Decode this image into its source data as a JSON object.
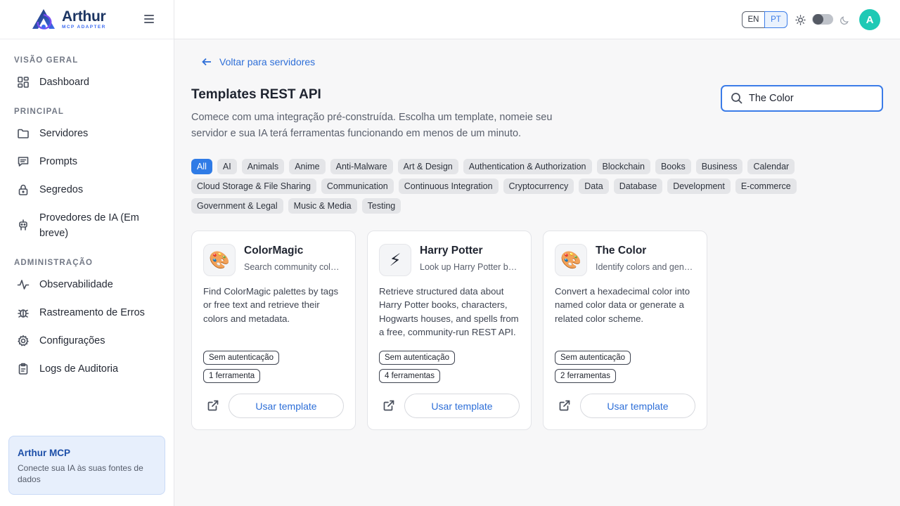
{
  "brand": {
    "name": "Arthur",
    "subtitle": "MCP ADAPTER"
  },
  "sidebar": {
    "sections": [
      {
        "title": "VISÃO GERAL"
      },
      {
        "title": "PRINCIPAL"
      },
      {
        "title": "ADMINISTRAÇÃO"
      }
    ],
    "items": [
      {
        "label": "Dashboard",
        "icon": "dashboard-icon"
      },
      {
        "label": "Servidores",
        "icon": "folder-icon"
      },
      {
        "label": "Prompts",
        "icon": "message-icon"
      },
      {
        "label": "Segredos",
        "icon": "lock-icon"
      },
      {
        "label": "Provedores de IA (Em breve)",
        "icon": "robot-icon"
      },
      {
        "label": "Observabilidade",
        "icon": "activity-icon"
      },
      {
        "label": "Rastreamento de Erros",
        "icon": "bug-icon"
      },
      {
        "label": "Configurações",
        "icon": "gear-icon"
      },
      {
        "label": "Logs de Auditoria",
        "icon": "clipboard-icon"
      }
    ],
    "promo": {
      "title": "Arthur MCP",
      "text": "Conecte sua IA às suas fontes de dados"
    }
  },
  "header": {
    "lang": {
      "en": "EN",
      "pt": "PT",
      "selected": "PT"
    },
    "avatar": "A",
    "theme_dark": false
  },
  "main": {
    "back_label": "Voltar para servidores",
    "title": "Templates REST API",
    "description": "Comece com uma integração pré-construída. Escolha um template, nomeie seu servidor e sua IA terá ferramentas funcionando em menos de um minuto.",
    "search": {
      "value": "The Color",
      "placeholder": ""
    },
    "categories": [
      "All",
      "AI",
      "Animals",
      "Anime",
      "Anti-Malware",
      "Art & Design",
      "Authentication & Authorization",
      "Blockchain",
      "Books",
      "Business",
      "Calendar",
      "Cloud Storage & File Sharing",
      "Communication",
      "Continuous Integration",
      "Cryptocurrency",
      "Data",
      "Database",
      "Development",
      "E-commerce",
      "Government & Legal",
      "Music & Media",
      "Testing"
    ],
    "active_category": "All",
    "cards": [
      {
        "icon": "🎨",
        "title": "ColorMagic",
        "subtitle": "Search community color palettes",
        "description": "Find ColorMagic palettes by tags or free text and retrieve their colors and metadata.",
        "auth": "Sem autenticação",
        "tools": "1 ferramenta",
        "button": "Usar template"
      },
      {
        "icon": "⚡",
        "title": "Harry Potter",
        "subtitle": "Look up Harry Potter books",
        "description": "Retrieve structured data about Harry Potter books, characters, Hogwarts houses, and spells from a free, community-run REST API.",
        "auth": "Sem autenticação",
        "tools": "4 ferramentas",
        "button": "Usar template"
      },
      {
        "icon": "🎨",
        "title": "The Color",
        "subtitle": "Identify colors and generate schemes",
        "description": "Convert a hexadecimal color into named color data or generate a related color scheme.",
        "auth": "Sem autenticação",
        "tools": "2 ferramentas",
        "button": "Usar template"
      }
    ]
  },
  "colors": {
    "accent": "#2f7be6",
    "avatar": "#1ec9b5",
    "promo_bg": "#e7effc"
  }
}
